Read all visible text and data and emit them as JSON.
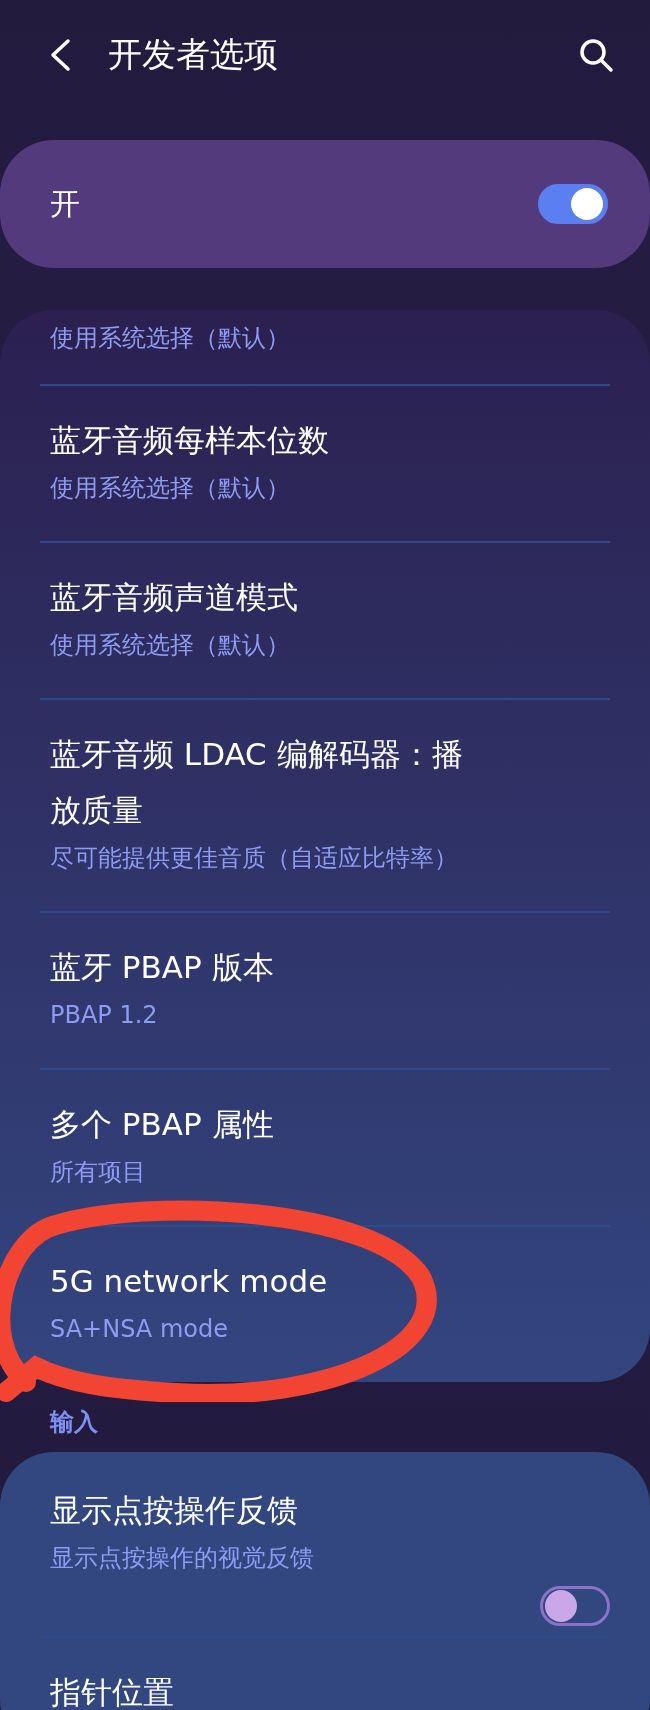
{
  "header": {
    "title": "开发者选项"
  },
  "master_switch": {
    "label": "开",
    "on": true
  },
  "sections": [
    {
      "items": [
        {
          "kind": "text",
          "summary": "使用系统选择（默认）",
          "highlighted": false
        },
        {
          "kind": "text",
          "title": "蓝牙音频每样本位数",
          "summary": "使用系统选择（默认）",
          "highlighted": false
        },
        {
          "kind": "text",
          "title": "蓝牙音频声道模式",
          "summary": "使用系统选择（默认）",
          "highlighted": false
        },
        {
          "kind": "text",
          "title": "蓝牙音频 LDAC 编解码器：播放质量",
          "summary": "尽可能提供更佳音质（自适应比特率）",
          "highlighted": false
        },
        {
          "kind": "text",
          "title": "蓝牙 PBAP 版本",
          "summary": "PBAP 1.2",
          "highlighted": false
        },
        {
          "kind": "text",
          "title": "多个 PBAP 属性",
          "summary": "所有项目",
          "highlighted": false
        },
        {
          "kind": "text",
          "title": "5G network mode",
          "summary": "SA+NSA mode",
          "highlighted": true
        }
      ]
    },
    {
      "header": "输入",
      "items": [
        {
          "kind": "switch",
          "title": "显示点按操作反馈",
          "summary": "显示点按操作的视觉反馈",
          "on": false
        },
        {
          "kind": "text",
          "title": "指针位置"
        }
      ]
    }
  ]
}
